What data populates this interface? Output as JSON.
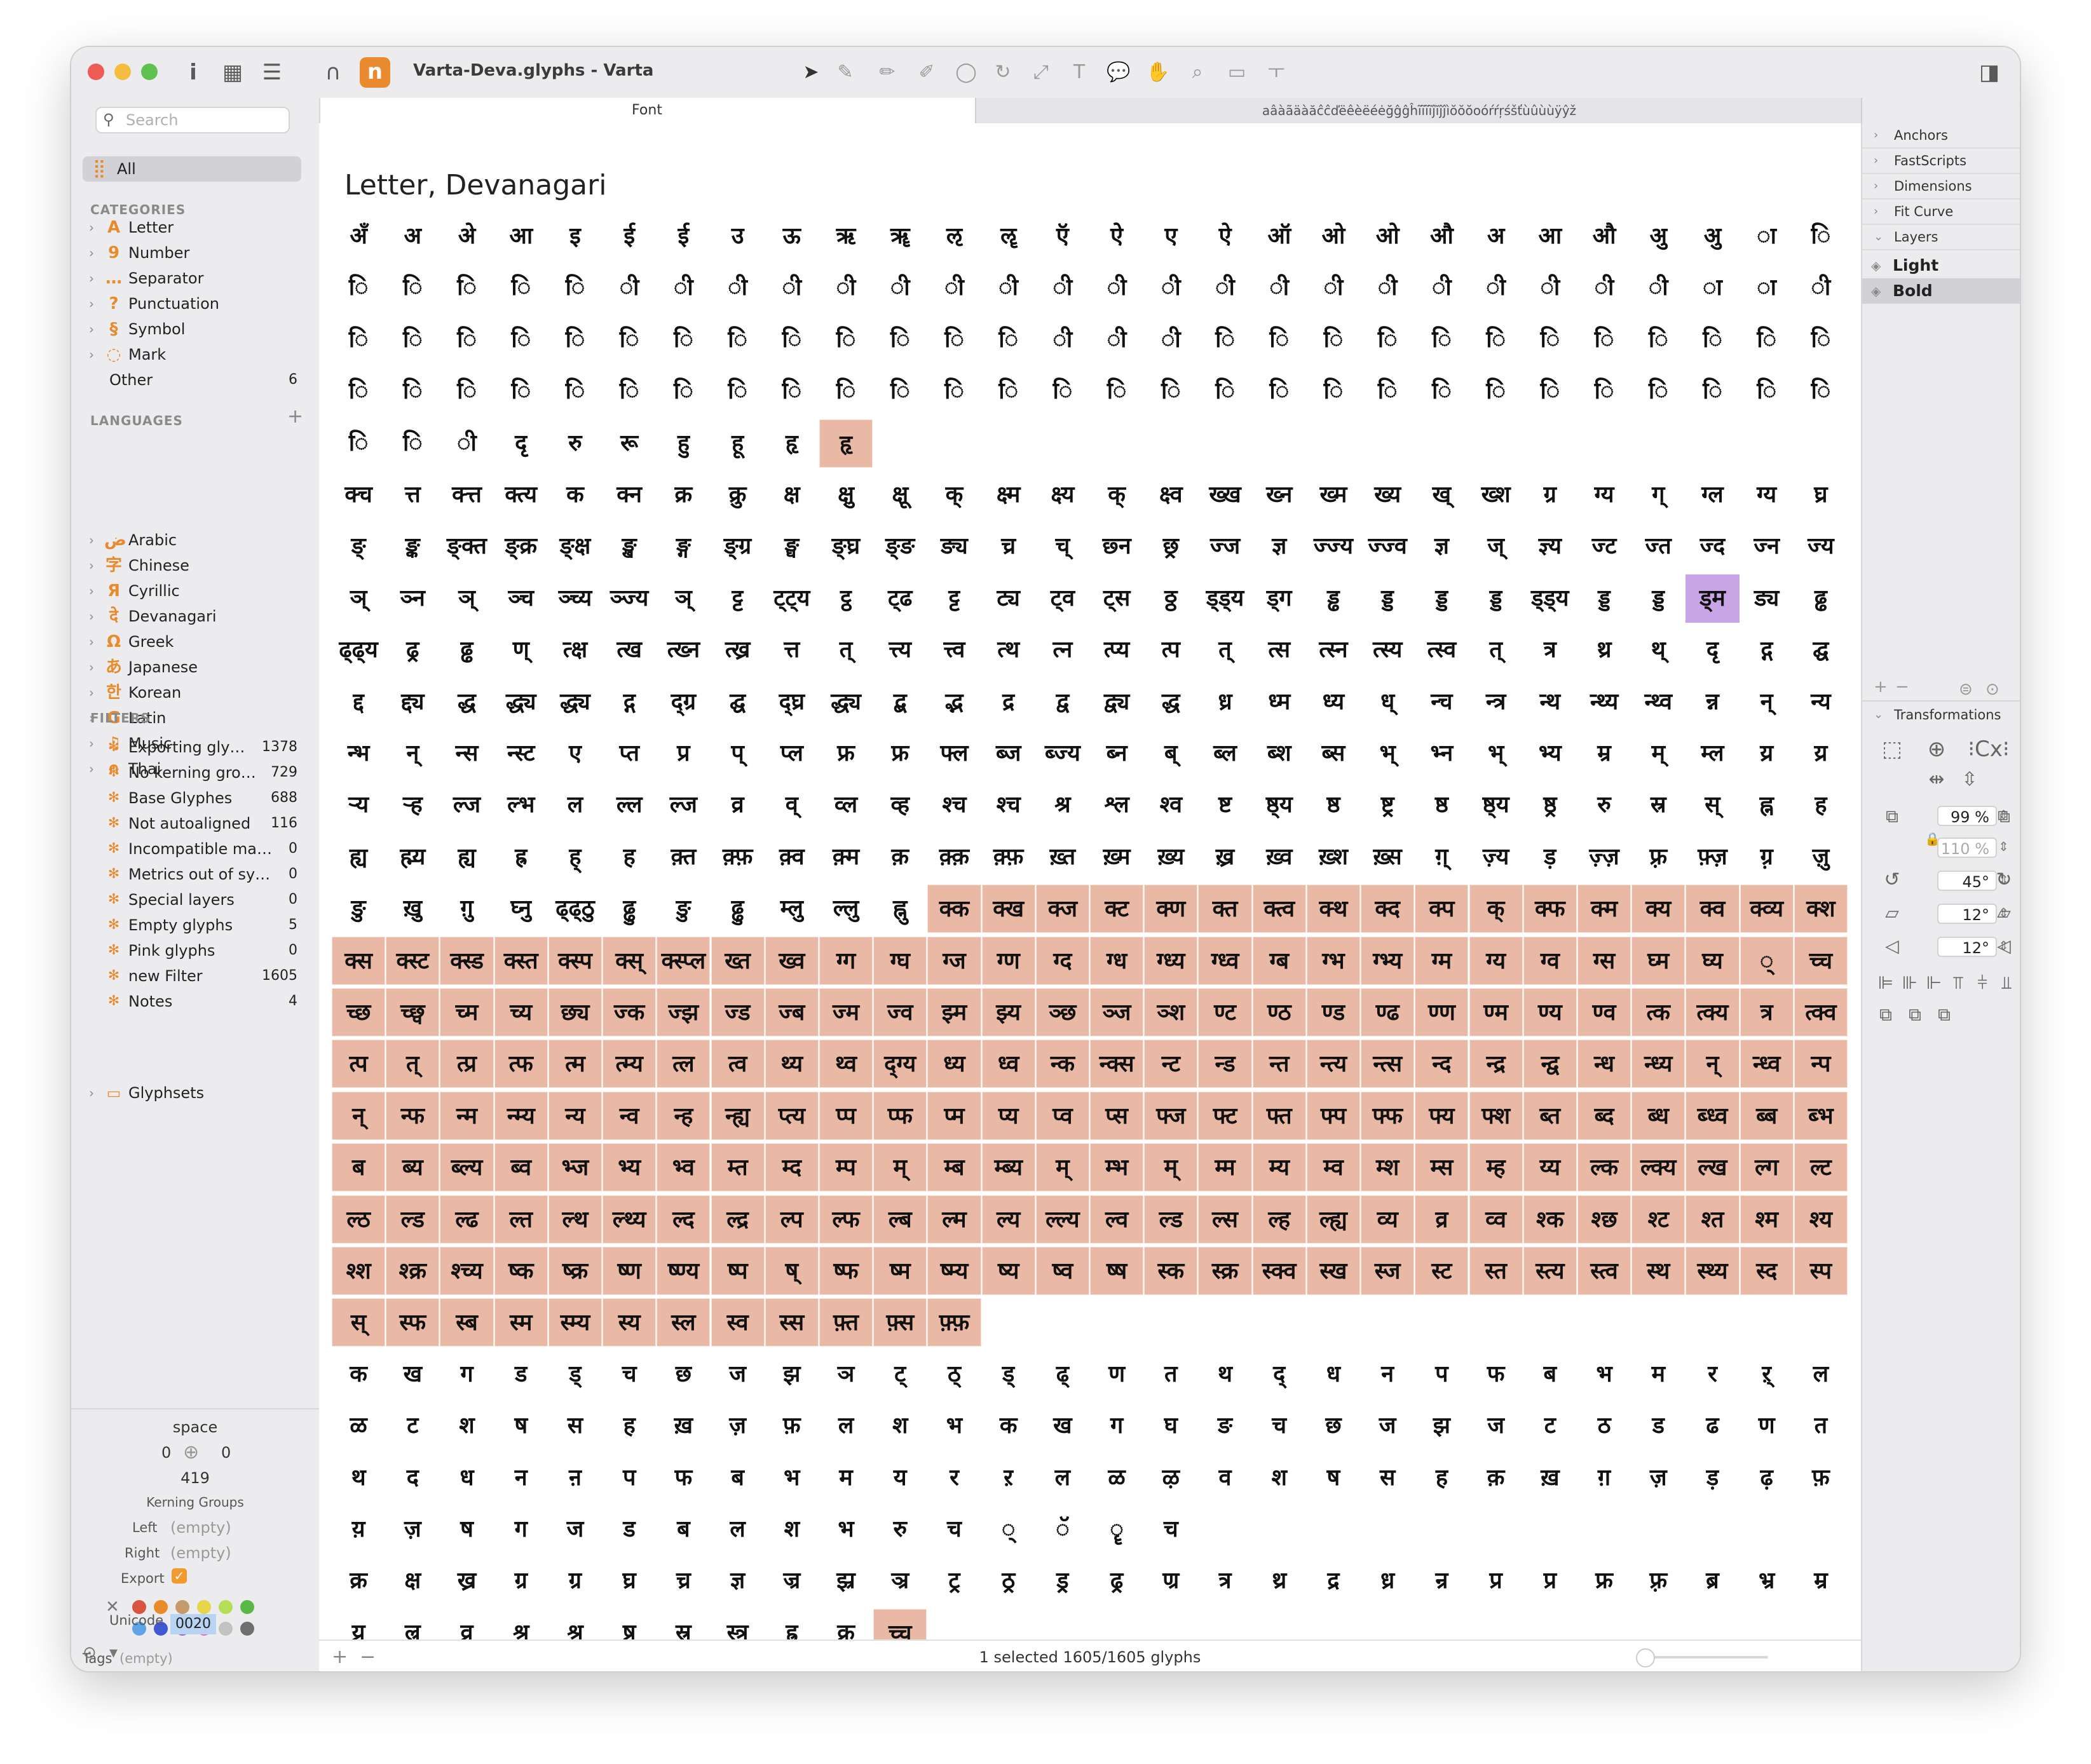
{
  "window": {
    "title": "Varta-Deva.glyphs - Varta",
    "tabs": [
      {
        "label": "Font"
      },
      {
        "label": "aâàãäàăĉĉďëêèëéėğĝĝĥĩĩĩĩĵĭĵĵìŏŏŏoóŕŕŗśšťùûùùÿŷž"
      }
    ]
  },
  "sidebar": {
    "search": {
      "placeholder": "Search"
    },
    "all": {
      "label": "All"
    },
    "categories_header": "CATEGORIES",
    "categories": [
      {
        "icon": "A",
        "label": "Letter"
      },
      {
        "icon": "9",
        "label": "Number"
      },
      {
        "icon": "…",
        "label": "Separator"
      },
      {
        "icon": "?",
        "label": "Punctuation"
      },
      {
        "icon": "§",
        "label": "Symbol"
      },
      {
        "icon": "◌",
        "label": "Mark"
      }
    ],
    "other": {
      "label": "Other",
      "count": "6"
    },
    "languages_header": "LANGUAGES",
    "languages_add": "+",
    "languages": [
      {
        "icon": "ض",
        "label": "Arabic"
      },
      {
        "icon": "字",
        "label": "Chinese"
      },
      {
        "icon": "Я",
        "label": "Cyrillic"
      },
      {
        "icon": "दे",
        "label": "Devanagari"
      },
      {
        "icon": "Ω",
        "label": "Greek"
      },
      {
        "icon": "あ",
        "label": "Japanese"
      },
      {
        "icon": "한",
        "label": "Korean"
      },
      {
        "icon": "G",
        "label": "Latin"
      },
      {
        "icon": "♫",
        "label": "Music"
      },
      {
        "icon": "ก",
        "label": "Thai"
      }
    ],
    "filters_header": "FILTERS",
    "filters": [
      {
        "label": "Exporting gly…",
        "count": "1378"
      },
      {
        "label": "No kerning gro…",
        "count": "729"
      },
      {
        "label": "Base Glyphes",
        "count": "688"
      },
      {
        "label": "Not autoaligned",
        "count": "116"
      },
      {
        "label": "Incompatible ma…",
        "count": "0"
      },
      {
        "label": "Metrics out of sy…",
        "count": "0"
      },
      {
        "label": "Special layers",
        "count": "0"
      },
      {
        "label": "Empty glyphs",
        "count": "5"
      },
      {
        "label": "Pink glyphs",
        "count": "0"
      },
      {
        "label": "new Filter",
        "count": "1605"
      },
      {
        "label": "Notes",
        "count": "4"
      }
    ],
    "glyphsets": {
      "label": "Glyphsets"
    },
    "info": {
      "glyph_name": "space",
      "lsb": "0",
      "rsb": "0",
      "width": "419",
      "kerning_groups": "Kerning Groups",
      "left_label": "Left",
      "left_value": "(empty)",
      "right_label": "Right",
      "right_value": "(empty)",
      "export_label": "Export",
      "tags_label": "Tags",
      "tags_value": "(empty)",
      "unicode_label": "Unicode",
      "unicode_value": "0020"
    },
    "color_labels": [
      "#d9543f",
      "#e98a2d",
      "#c79a6a",
      "#e8d44a",
      "#b6dd57",
      "#58b947",
      "#5fa4e8",
      "#4058d6",
      "#9a5bd5",
      "#e06bb8",
      "#c2c2c2",
      "#6f6f6f"
    ]
  },
  "main": {
    "section_title": "Letter, Devanagari",
    "status": "1 selected 1605/1605 glyphs",
    "status_add": "+",
    "status_remove": "−"
  },
  "glyph_rows": [
    [
      "अँ",
      "अ",
      "अे",
      "आ",
      "इ",
      "ई",
      "ई",
      "उ",
      "ऊ",
      "ऋ",
      "ॠ",
      "ऌ",
      "ॡ",
      "ऍ",
      "ऐ",
      "ए",
      "ऐ",
      "ऑ",
      "ओ",
      "ओ",
      "औ",
      "अ",
      "आ",
      "औ",
      "अु",
      "अु",
      "ा",
      "ि"
    ],
    [
      "ि",
      "ि",
      "ि",
      "ि",
      "ि",
      "ी",
      "ी",
      "ी",
      "ी",
      "ी",
      "ी",
      "ी",
      "ी",
      "ी",
      "ी",
      "ी",
      "ी",
      "ी",
      "ी",
      "ी",
      "ी",
      "ी",
      "ी",
      "ी",
      "ी",
      "ा",
      "ा",
      "ी"
    ],
    [
      "ि",
      "ि",
      "ि",
      "ि",
      "ि",
      "ि",
      "ि",
      "ि",
      "ि",
      "ि",
      "ि",
      "ि",
      "ि",
      "ी",
      "ी",
      "ी",
      "ि",
      "ि",
      "ि",
      "ि",
      "ि",
      "ि",
      "ि",
      "ि",
      "ि",
      "ि",
      "ि",
      "ि"
    ],
    [
      "ि",
      "ि",
      "ि",
      "ि",
      "ि",
      "ि",
      "ि",
      "ि",
      "ि",
      "ि",
      "ि",
      "ि",
      "ि",
      "ि",
      "ि",
      "ि",
      "ि",
      "ि",
      "ि",
      "ि",
      "ि",
      "ि",
      "ि",
      "ि",
      "ि",
      "ि",
      "ि",
      "ि"
    ],
    [
      "ि",
      "ि",
      "ी",
      "दृ",
      "रु",
      "रू",
      "हु",
      "हू",
      "हृ",
      "हृ"
    ],
    [
      "क्च",
      "त्त",
      "क्त्त",
      "क्त्य",
      "क",
      "क्न",
      "क्र",
      "क्रु",
      "क्ष",
      "क्षु",
      "क्षू",
      "क्",
      "क्ष्म",
      "क्ष्य",
      "क्",
      "क्ष्व",
      "ख्ख",
      "ख्न",
      "ख्म",
      "ख्य",
      "ख्",
      "ख्श",
      "ग्र",
      "ग्य",
      "ग्",
      "ग्ल",
      "ग्य",
      "घ्र"
    ],
    [
      "ङ्",
      "ङ्क",
      "ङ्क्त",
      "ङ्क्र",
      "ङ्क्ष",
      "ङ्ख",
      "ङ्ग",
      "ङ्ग्र",
      "ङ्घ",
      "ङ्घ्र",
      "ङ्ङ",
      "ङ्य",
      "च्र",
      "च्",
      "छ्न",
      "छ्र",
      "ज्ज",
      "ज्ञ",
      "ज्ज्य",
      "ज्ज्व",
      "ज्ञ",
      "ज्",
      "ज्ञ्य",
      "ज्ट",
      "ज्त",
      "ज्द",
      "ज्न",
      "ज्य"
    ],
    [
      "ञ्",
      "ञ्न",
      "ञ्",
      "ञ्च",
      "ञ्च्य",
      "ञ्ज्य",
      "ञ्",
      "ट्ट",
      "ट्ट्य",
      "ट्ठ",
      "ट्ढ",
      "ट्ट",
      "ट्य",
      "ट्व",
      "ट्स",
      "ठ्ठ",
      "ड्ड्य",
      "ड्ग",
      "ड्ढ",
      "ड्ड",
      "ड्ड",
      "ड्ड",
      "ड्ड्य",
      "ड्ड",
      "ड्ड",
      "ड्म",
      "ड्य",
      "ढ्ढ"
    ],
    [
      "ढ्ढ्य",
      "ढ्र",
      "ढ्ढ",
      "ण्",
      "त्क्ष",
      "त्ख",
      "त्ख्न",
      "त्ख्र",
      "त्त",
      "त्",
      "त्त्य",
      "त्त्व",
      "त्थ",
      "त्न",
      "त्प्य",
      "त्प",
      "त्",
      "त्स",
      "त्स्न",
      "त्स्य",
      "त्स्व",
      "त्",
      "त्र",
      "थ्र",
      "थ्",
      "दृ",
      "द्ग",
      "द्घ"
    ],
    [
      "द्द",
      "द्द्य",
      "द्ध",
      "द्ध्य",
      "द्ध्य",
      "द्ग",
      "द्ग्र",
      "द्घ",
      "द्घ्र",
      "द्ध्य",
      "द्ब",
      "द्भ",
      "द्र",
      "द्व",
      "द्व्य",
      "द्ध",
      "ध्र",
      "ध्म",
      "ध्य",
      "ध्",
      "न्च",
      "न्त्र",
      "न्थ",
      "न्थ्य",
      "न्थ्व",
      "न्न",
      "न्",
      "न्य"
    ],
    [
      "न्भ",
      "न्",
      "न्स",
      "न्स्ट",
      "ए",
      "प्त",
      "प्र",
      "प्",
      "प्ल",
      "फ्र",
      "फ्र",
      "फ्ल",
      "ब्ज",
      "ब्ज्य",
      "ब्न",
      "ब्",
      "ब्ल",
      "ब्श",
      "ब्स",
      "भ्",
      "भ्न",
      "भ्",
      "भ्य",
      "म्र",
      "म्",
      "म्ल",
      "य्र",
      "य्र"
    ],
    [
      "ऱ्य",
      "ऱ्ह",
      "ल्ज",
      "ल्भ",
      "ल",
      "ल्ल",
      "ल्ज",
      "व्र",
      "व्",
      "व्ल",
      "व्ह",
      "श्च",
      "श्च",
      "श्र",
      "श्ल",
      "श्व",
      "ष्ट",
      "ष्ठ्य",
      "ष्ठ",
      "ष्ट्र",
      "ष्ठ",
      "ष्ठ्य",
      "ष्ठ्र",
      "रु",
      "स्र",
      "स्",
      "ह्न",
      "ह"
    ],
    [
      "ह्य",
      "ह्म्य",
      "ह्य",
      "ह्र",
      "ह्",
      "ह",
      "क़्त",
      "क़्फ़",
      "क़्व",
      "क़्म",
      "क़",
      "क़्क़",
      "क़्फ़",
      "ख़्त",
      "ख़्म",
      "ख़्य",
      "ख़्र",
      "ख़्व",
      "ख़्श",
      "ख़्स",
      "ग़्",
      "ज़्य",
      "ड़",
      "ज़्ज़",
      "फ़्र",
      "फ़्ज़",
      "ग़्र",
      "ज़ु"
    ],
    [
      "ङु",
      "ख़ु",
      "ग़ु",
      "घ्नु",
      "ढ्ढ्ठु",
      "ढ्ढु",
      "ङु",
      "ढ्ढु",
      "म्लु",
      "ल्लु",
      "ह्नु",
      "क्क",
      "क्ख",
      "क्ज",
      "क्ट",
      "क्ण",
      "क्त",
      "क्त्व",
      "क्थ",
      "क्द",
      "क्प",
      "क्",
      "क्फ",
      "क्म",
      "क्य",
      "क्व",
      "क्व्य",
      "क्श"
    ],
    [
      "क्स",
      "क्स्ट",
      "क्स्ड",
      "क्स्त",
      "क्स्प",
      "क्स्",
      "क्स्प्ल",
      "ख्त",
      "ख्व",
      "ग्ग",
      "ग्घ",
      "ग्ज",
      "ग्ण",
      "ग्द",
      "ग्ध",
      "ग्ध्य",
      "ग्ध्व",
      "ग्ब",
      "ग्भ",
      "ग्भ्य",
      "ग्म",
      "ग्य",
      "ग्व",
      "ग्स",
      "घ्म",
      "घ्य",
      "्",
      "च्च"
    ],
    [
      "च्छ",
      "च्छ्व",
      "च्म",
      "च्य",
      "छ्य",
      "ज्क",
      "ज्झ",
      "ज्ड",
      "ज्ब",
      "ज्म",
      "ज्व",
      "झ्म",
      "झ्य",
      "ञ्छ",
      "ञ्ज",
      "ञ्श",
      "ण्ट",
      "ण्ठ",
      "ण्ड",
      "ण्ढ",
      "ण्ण",
      "ण्म",
      "ण्य",
      "ण्व",
      "त्क",
      "त्क्य",
      "त्र",
      "त्क्व"
    ],
    [
      "त्प",
      "त्",
      "त्प्र",
      "त्फ",
      "त्म",
      "त्म्य",
      "त्ल",
      "त्व",
      "थ्य",
      "थ्व",
      "द्ग्य",
      "ध्य",
      "ध्व",
      "न्क",
      "न्क्स",
      "न्ट",
      "न्ड",
      "न्त",
      "न्त्य",
      "न्त्स",
      "न्द",
      "न्द्र",
      "न्द्व",
      "न्ध",
      "न्ध्य",
      "न्",
      "न्ध्व",
      "न्प"
    ],
    [
      "न्",
      "न्फ",
      "न्म",
      "न्म्य",
      "न्य",
      "न्व",
      "न्ह",
      "न्ह्य",
      "प्त्य",
      "प्प",
      "प्फ",
      "प्म",
      "प्य",
      "प्व",
      "प्स",
      "फ्ज",
      "फ्ट",
      "फ्त",
      "फ्प",
      "फ्फ",
      "फ्य",
      "फ्श",
      "ब्त",
      "ब्द",
      "ब्ध",
      "ब्ध्व",
      "ब्ब",
      "ब्भ"
    ],
    [
      "ब",
      "ब्य",
      "ब्ल्य",
      "ब्व",
      "भ्ज",
      "भ्य",
      "भ्व",
      "म्त",
      "म्द",
      "म्प",
      "म्",
      "म्ब",
      "म्ब्य",
      "म्",
      "म्भ",
      "म्",
      "म्म",
      "म्य",
      "म्व",
      "म्श",
      "म्स",
      "म्ह",
      "य्य",
      "ल्क",
      "ल्क्य",
      "ल्ख",
      "ल्ग",
      "ल्ट"
    ],
    [
      "ल्ठ",
      "ल्ड",
      "ल्ढ",
      "ल्त",
      "ल्थ",
      "ल्थ्य",
      "ल्द",
      "ल्द्र",
      "ल्प",
      "ल्फ",
      "ल्ब",
      "ल्म",
      "ल्य",
      "ल्ल्य",
      "ल्व",
      "ल्ड",
      "ल्स",
      "ल्ह",
      "ल्ह्य",
      "व्य",
      "व्र",
      "व्व",
      "श्क",
      "श्छ",
      "श्ट",
      "श्त",
      "श्म",
      "श्य"
    ],
    [
      "श्श",
      "श्क्र",
      "श्च्य",
      "ष्क",
      "ष्क्र",
      "ष्ण",
      "ष्ण्य",
      "ष्प",
      "ष्",
      "ष्फ",
      "ष्म",
      "ष्म्य",
      "ष्य",
      "ष्व",
      "ष्ष",
      "स्क",
      "स्क्र",
      "स्क्व",
      "स्ख",
      "स्ज",
      "स्ट",
      "स्त",
      "स्त्य",
      "स्त्व",
      "स्थ",
      "स्थ्य",
      "स्द",
      "स्प"
    ],
    [
      "स्",
      "स्फ",
      "स्ब",
      "स्म",
      "स्म्य",
      "स्य",
      "स्ल",
      "स्व",
      "स्स",
      "फ़्त",
      "फ़्स",
      "फ़्फ़"
    ],
    [
      "क",
      "ख",
      "ग",
      "ड",
      "ड्",
      "च",
      "छ",
      "ज",
      "झ",
      "ञ",
      "ट्",
      "ठ्",
      "ड्",
      "ढ्",
      "ण",
      "त",
      "थ",
      "द्",
      "ध",
      "न",
      "प",
      "फ",
      "ब",
      "भ",
      "म",
      "र",
      "ऱ्",
      "ल"
    ],
    [
      "ळ",
      "ट",
      "श",
      "ष",
      "स",
      "ह",
      "ख़",
      "ज़",
      "फ़",
      "ल",
      "श",
      "भ",
      "क",
      "ख",
      "ग",
      "घ",
      "ङ",
      "च",
      "छ",
      "ज",
      "झ",
      "ज",
      "ट",
      "ठ",
      "ड",
      "ढ",
      "ण",
      "त"
    ],
    [
      "थ",
      "द",
      "ध",
      "न",
      "ऩ",
      "प",
      "फ",
      "ब",
      "भ",
      "म",
      "य",
      "र",
      "ऱ",
      "ल",
      "ळ",
      "ऴ",
      "व",
      "श",
      "ष",
      "स",
      "ह",
      "क़",
      "ख़",
      "ग़",
      "ज़",
      "ड़",
      "ढ़",
      "फ़"
    ],
    [
      "य़",
      "ज़",
      "ष",
      "ग",
      "ज",
      "ड",
      "ब",
      "ल",
      "श",
      "भ",
      "रु",
      "च",
      "्",
      "ॅ",
      "ॄ",
      "च"
    ],
    [
      "क्र",
      "क्ष",
      "ख्र",
      "ग्र",
      "ग्र",
      "घ्र",
      "च्र",
      "ज्ञ",
      "ज्र",
      "झ्र",
      "ञ्र",
      "ट्र",
      "ठ्र",
      "ड्र",
      "ढ्र",
      "ण्र",
      "त्र",
      "थ्र",
      "द्र",
      "ध्र",
      "न्र",
      "प्र",
      "प्र",
      "फ्र",
      "फ़्र",
      "ब्र",
      "भ्र",
      "म्र"
    ],
    [
      "य्र",
      "ल्र",
      "व्र",
      "श्र",
      "श्रृ",
      "ष्र",
      "स्र",
      "स्त्र",
      "ह्र",
      "क्र",
      "च्च्"
    ]
  ],
  "right_panel": {
    "sections": [
      {
        "label": "Anchors"
      },
      {
        "label": "FastScripts"
      },
      {
        "label": "Dimensions"
      },
      {
        "label": "Fit Curve"
      },
      {
        "label": "Layers"
      }
    ],
    "layers": [
      {
        "label": "Light"
      },
      {
        "label": "Bold"
      }
    ],
    "transformations_label": "Transformations",
    "scale_x": "99 %",
    "scale_y": "110 %",
    "rotate": "45°",
    "slant_x": "12°",
    "slant_y": "12°"
  }
}
